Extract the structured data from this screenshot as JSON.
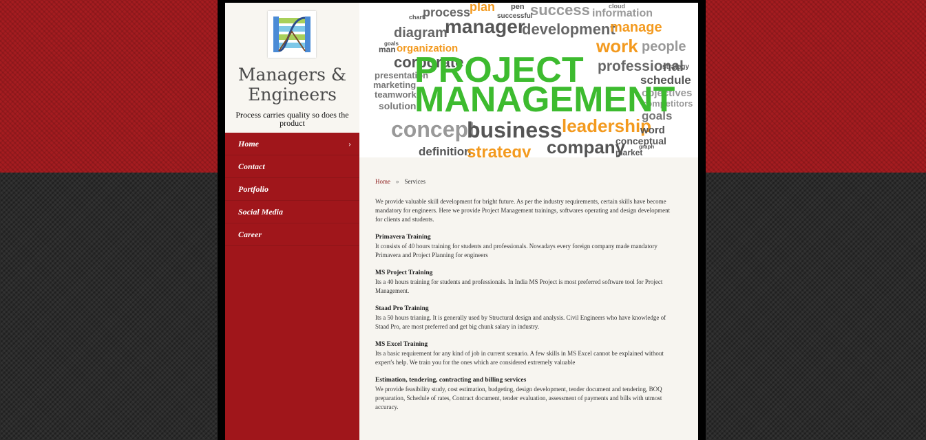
{
  "site": {
    "title": "Managers & Engineers",
    "tagline": "Process carries quality so does the product"
  },
  "nav": {
    "items": [
      {
        "label": "Home",
        "active": true
      },
      {
        "label": "Contact"
      },
      {
        "label": "Portfolio"
      },
      {
        "label": "Social Media"
      },
      {
        "label": "Career"
      }
    ],
    "chevron": "›"
  },
  "banner": {
    "main_line1": "PROJECT",
    "main_line2": "MANAGEMENT",
    "words": [
      "plan",
      "process",
      "success",
      "information",
      "cloud",
      "chart",
      "manager",
      "development",
      "manage",
      "diagram",
      "goals",
      "work",
      "people",
      "man",
      "organization",
      "corporate",
      "professional",
      "presentation",
      "schedule",
      "marketing",
      "objectives",
      "teamwork",
      "competitors",
      "solution",
      "goals",
      "concept",
      "business",
      "leadership",
      "word",
      "company",
      "conceptual",
      "definition",
      "strategy",
      "market",
      "graph",
      "strategy",
      "successful",
      "pen"
    ]
  },
  "breadcrumb": {
    "home": "Home",
    "separator": "»",
    "current": "Services"
  },
  "content": {
    "intro": "We provide valuable skill development for bright future. As per the industry requirements, certain skills have become mandatory for engineers. Here we provide Project Management trainings, softwares operating and design development for clients and students.",
    "sections": [
      {
        "title": "Primavera Training",
        "text": "It consists of 40 hours training for students and professionals. Nowadays every foreign company made mandatory Primavera and Project Planning for engineers"
      },
      {
        "title": "MS Project Training",
        "text": "Its a 40 hours training for students and professionals. In India MS Project is most preferred software tool for Project Management."
      },
      {
        "title": "Staad Pro Training",
        "text": "Its a 50 hours trianing. It is generally used by Structural design and analysis. Civil Engineers who have knowledge of Staad Pro, are most preferred and get big chunk salary in industry."
      },
      {
        "title": "MS Excel Training",
        "text": "Its a basic requirement for any kind of job in current scenario. A few skills in MS Excel cannot be explained without expert's help. We train you for the ones which are considered extremely valuable"
      },
      {
        "title": "Estimation, tendering, contracting and billing services",
        "text": "We provide feasibility study, cost estimation, budgeting, design development, tender document and tendering, BOQ preparation, Schedule of rates, Contract document, tender evaluation, assessment of payments and bills with utmost accuracy."
      }
    ]
  },
  "colors": {
    "accent_red": "#a0161b",
    "green": "#3dbb2f",
    "orange": "#f39a1f",
    "gray": "#666666"
  },
  "icons": {
    "logo": "me-logo-icon"
  }
}
